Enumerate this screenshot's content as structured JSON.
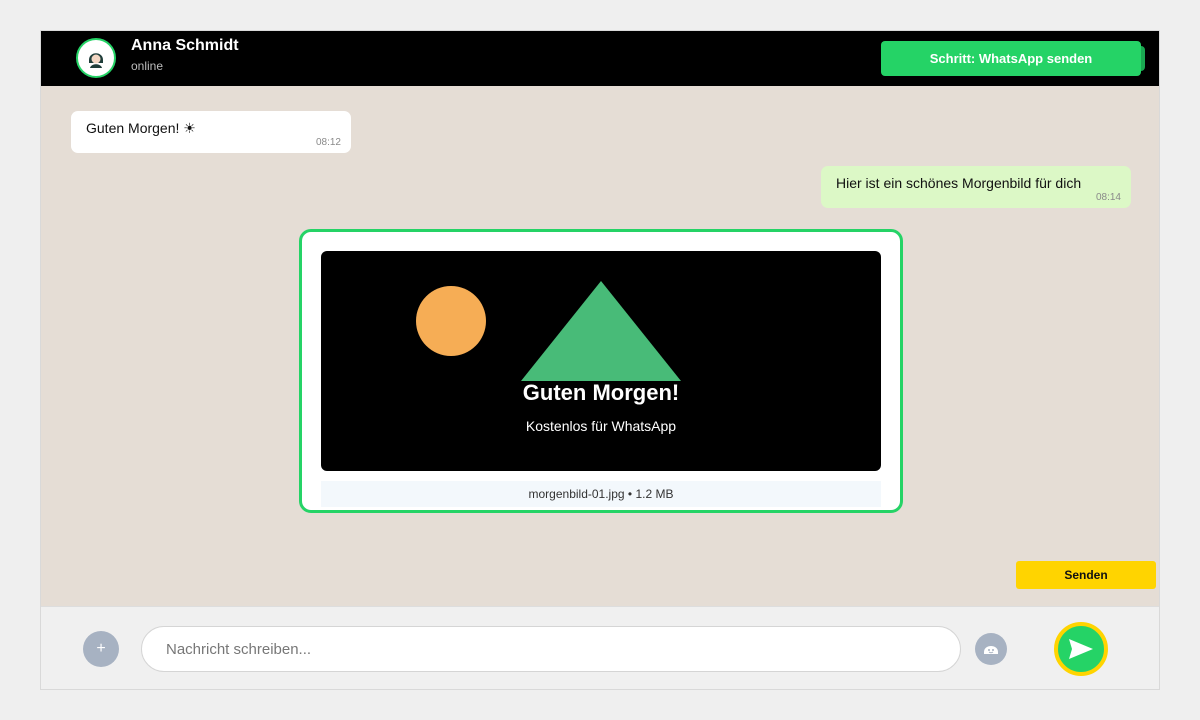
{
  "header": {
    "contact_name": "Anna Schmidt",
    "contact_status": "online",
    "step_button_label": "Schritt: WhatsApp senden"
  },
  "messages": [
    {
      "direction": "incoming",
      "text": "Guten Morgen! ☀",
      "time": "08:12"
    },
    {
      "direction": "outgoing",
      "text": "Hier ist ein schönes Morgenbild für dich",
      "time": "08:14"
    }
  ],
  "media": {
    "image_title": "Guten Morgen!",
    "image_subtitle": "Kostenlos für WhatsApp",
    "file_info": "morgenbild-01.jpg • 1.2 MB"
  },
  "actions": {
    "send_label": "Senden"
  },
  "composer": {
    "placeholder": "Nachricht schreiben...",
    "plus_label": "+",
    "send_icon": "send-arrow-icon",
    "emoji_icon": "emoji-icon",
    "attach_icon": "plus-icon"
  },
  "colors": {
    "brand_green": "#25d366",
    "header_bg": "#000000",
    "chat_bg": "#e5ddd5",
    "outgoing_bubble": "#dcf8c6",
    "highlight_yellow": "#ffd400",
    "sun": "#f6ad55",
    "mountain": "#48bb78"
  }
}
